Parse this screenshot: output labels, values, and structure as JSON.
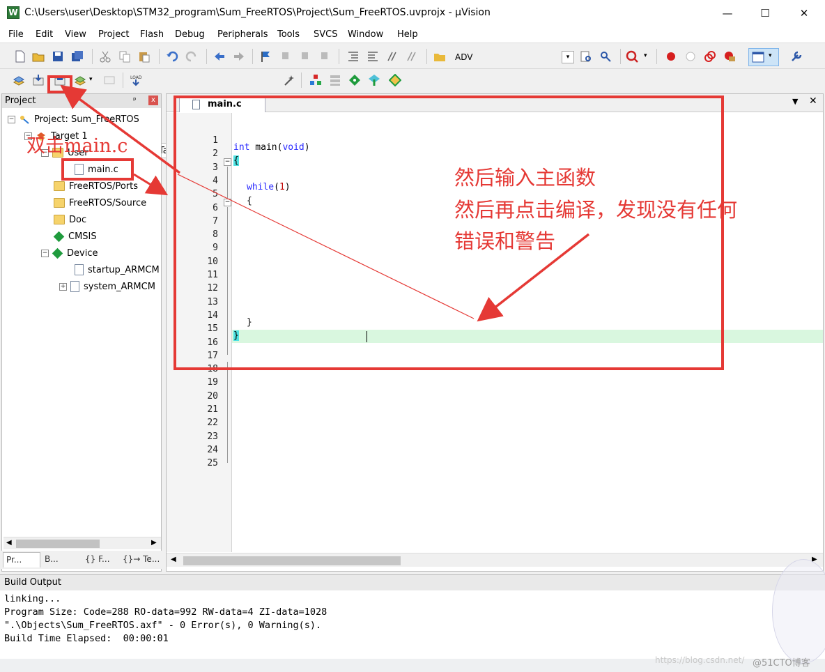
{
  "window": {
    "title": "C:\\Users\\user\\Desktop\\STM32_program\\Sum_FreeRTOS\\Project\\Sum_FreeRTOS.uvprojx - µVision",
    "app_icon": "W",
    "minimize": "—",
    "maximize": "☐",
    "close": "✕"
  },
  "menu": [
    "File",
    "Edit",
    "View",
    "Project",
    "Flash",
    "Debug",
    "Peripherals",
    "Tools",
    "SVCS",
    "Window",
    "Help"
  ],
  "toolbar": {
    "adv_label": "ADV",
    "target_select": "Target 1",
    "target_arrow": "▾"
  },
  "project_panel": {
    "title": "Project",
    "pin": "ᵖ",
    "close": "x",
    "tree": {
      "root": "Project: Sum_FreeRTOS",
      "target": "Target 1",
      "user": "User",
      "main_c": "main.c",
      "freertos_ports": "FreeRTOS/Ports",
      "freertos_source": "FreeRTOS/Source",
      "doc": "Doc",
      "cmsis": "CMSIS",
      "device": "Device",
      "startup": "startup_ARMCM",
      "system": "system_ARMCM"
    },
    "tabs": [
      "Pr...",
      "B...",
      "{} F...",
      "{}→ Te..."
    ]
  },
  "editor": {
    "tab": "main.c",
    "line_numbers": [
      "1",
      "2",
      "3",
      "4",
      "5",
      "6",
      "7",
      "8",
      "9",
      "10",
      "11",
      "12",
      "13",
      "14",
      "15",
      "16",
      "17",
      "18",
      "19",
      "20",
      "21",
      "22",
      "23",
      "24",
      "25"
    ],
    "code": {
      "l3_kw": "int",
      "l3_name": " main(",
      "l3_void": "void",
      "l3_close": ")",
      "l4": "{",
      "l6_kw": "while",
      "l6_open": "(",
      "l6_num": "1",
      "l6_close": ")",
      "l7": "{",
      "l16": "}",
      "l17": "}"
    }
  },
  "build_output": {
    "title": "Build Output",
    "lines": [
      "linking...",
      "Program Size: Code=288 RO-data=992 RW-data=4 ZI-data=1028",
      "\".\\Objects\\Sum_FreeRTOS.axf\" - 0 Error(s), 0 Warning(s).",
      "Build Time Elapsed:  00:00:01"
    ]
  },
  "annotations": {
    "left": "双击main.c",
    "right_line1": "然后输入主函数",
    "right_line2": "然后再点击编译，发现没有任何",
    "right_line3": "错误和警告",
    "color": "#e53935"
  },
  "watermark": "https://blog.csdn.net/",
  "watermark_51": "@51CTO博客"
}
